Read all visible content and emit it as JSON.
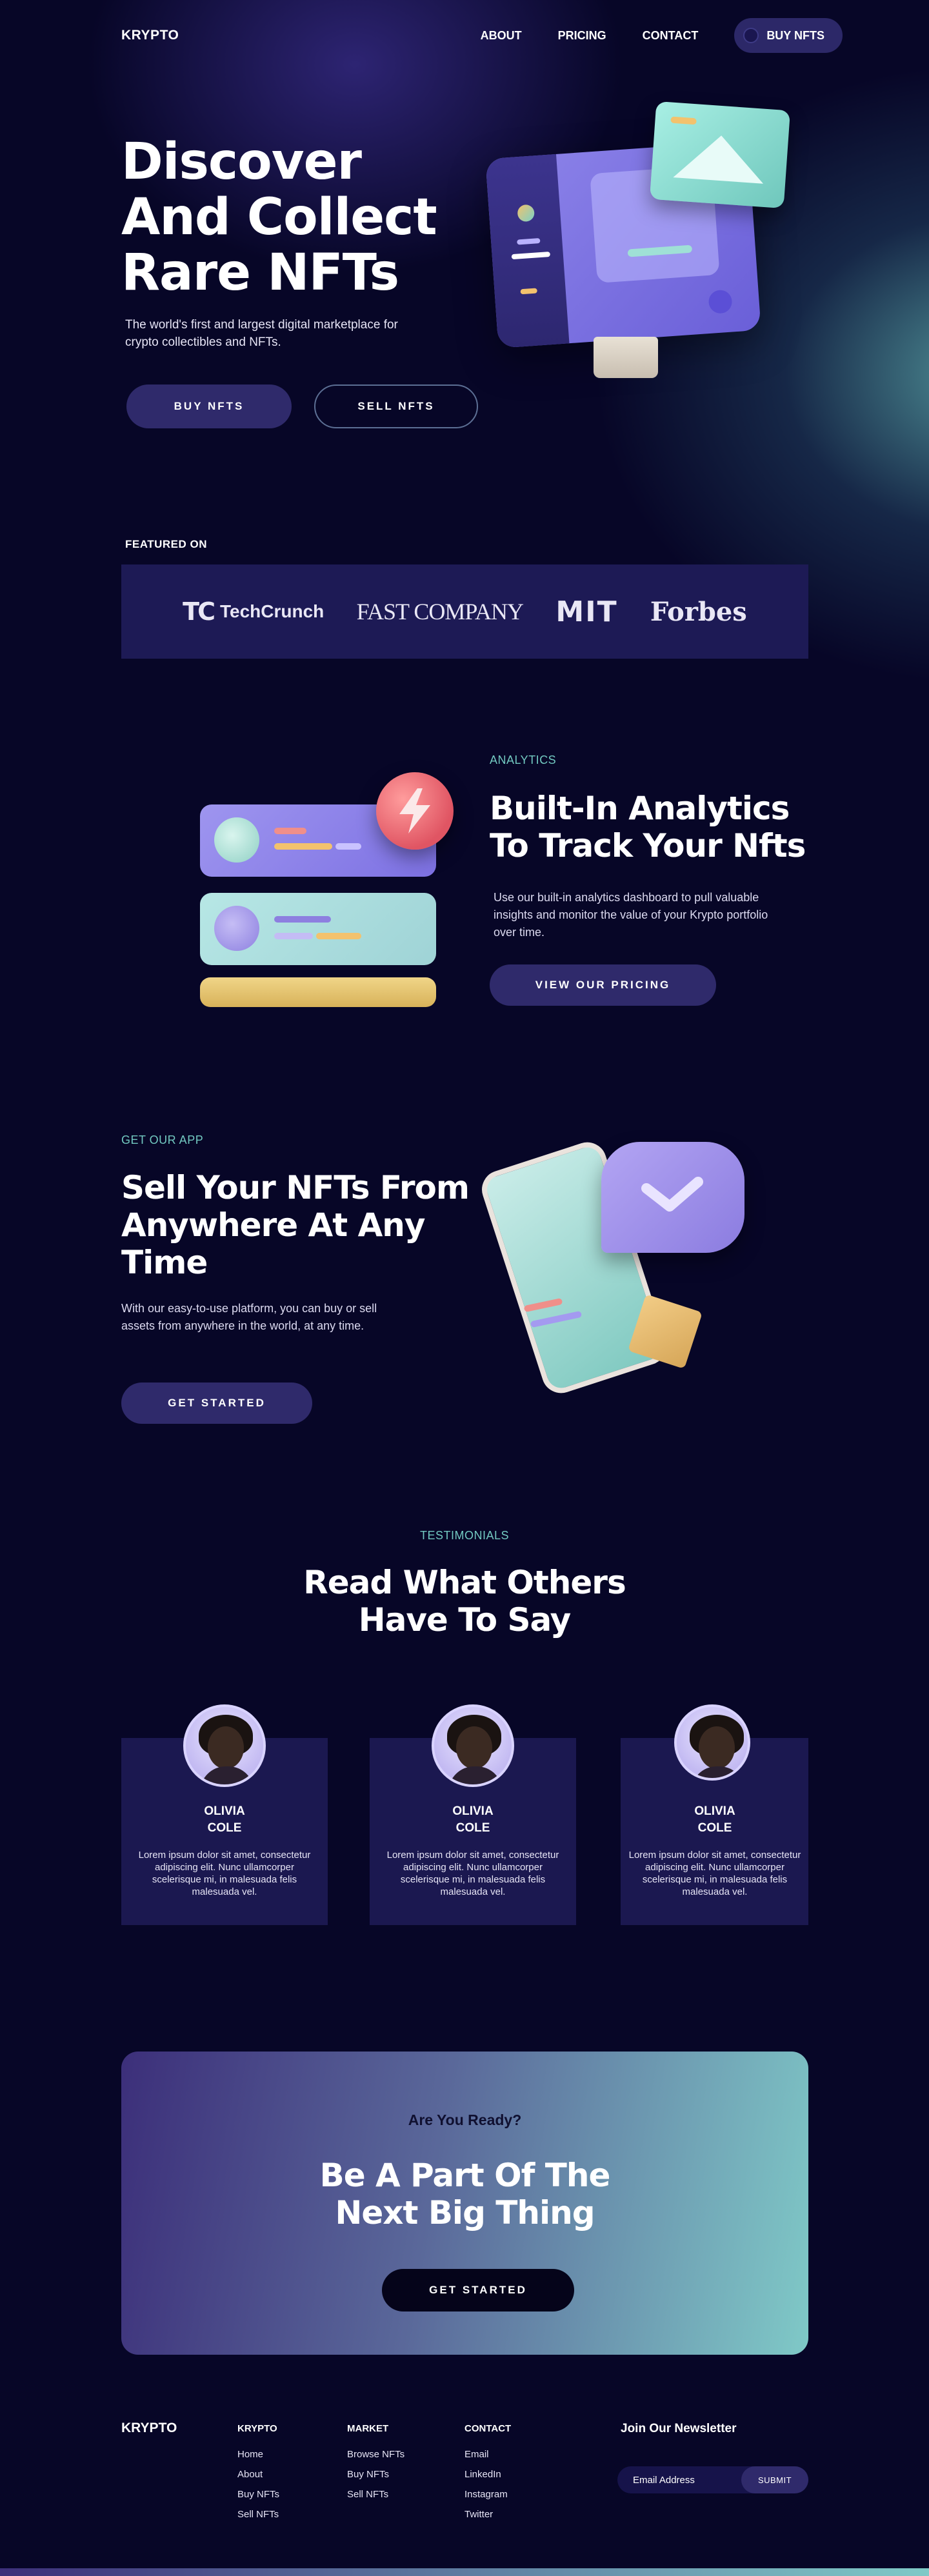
{
  "nav": {
    "logo": "KRYPTO",
    "links": [
      "ABOUT",
      "PRICING",
      "CONTACT"
    ],
    "cta": "BUY NFTS"
  },
  "hero": {
    "title_lines": [
      "Discover",
      "And Collect",
      "Rare NFTs"
    ],
    "subtitle": "The world's first and largest digital marketplace for crypto collectibles and NFTs.",
    "buy_button": "BUY NFTS",
    "sell_button": "SELL NFTS"
  },
  "featured": {
    "label": "FEATURED ON",
    "brands": [
      "TechCrunch",
      "FAST COMPANY",
      "MIT",
      "Forbes"
    ]
  },
  "analytics": {
    "eyebrow": "ANALYTICS",
    "title_lines": [
      "Built-In Analytics",
      "To Track Your Nfts"
    ],
    "body": "Use our built-in analytics dashboard to pull valuable insights and monitor the value of your Krypto portfolio over time.",
    "button": "VIEW OUR PRICING"
  },
  "app": {
    "eyebrow": "GET OUR APP",
    "title_lines": [
      "Sell Your NFTs From",
      "Anywhere At Any",
      "Time"
    ],
    "body": "With our easy-to-use platform, you can buy or sell assets from anywhere in the world, at any time.",
    "button": "GET STARTED"
  },
  "testimonials": {
    "eyebrow": "TESTIMONIALS",
    "title_lines": [
      "Read What Others",
      "Have To Say"
    ],
    "items": [
      {
        "first": "OLIVIA",
        "last": "COLE",
        "text": "Lorem ipsum dolor sit amet, consectetur adipiscing elit. Nunc ullamcorper scelerisque mi, in malesuada felis malesuada vel."
      },
      {
        "first": "OLIVIA",
        "last": "COLE",
        "text": "Lorem ipsum dolor sit amet, consectetur adipiscing elit. Nunc ullamcorper scelerisque mi, in malesuada felis malesuada vel."
      },
      {
        "first": "OLIVIA",
        "last": "COLE",
        "text": "Lorem ipsum dolor sit amet, consectetur adipiscing elit. Nunc ullamcorper scelerisque mi, in malesuada felis malesuada vel."
      }
    ]
  },
  "cta": {
    "eyebrow": "Are You Ready?",
    "title_lines": [
      "Be A Part Of The",
      "Next Big Thing"
    ],
    "button": "GET STARTED"
  },
  "footer": {
    "logo": "KRYPTO",
    "columns": [
      {
        "title": "KRYPTO",
        "links": [
          "Home",
          "About",
          "Buy NFTs",
          "Sell NFTs"
        ]
      },
      {
        "title": "MARKET",
        "links": [
          "Browse NFTs",
          "Buy NFTs",
          "Sell NFTs"
        ]
      },
      {
        "title": "CONTACT",
        "links": [
          "Email",
          "LinkedIn",
          "Instagram",
          "Twitter"
        ]
      }
    ],
    "newsletter": {
      "title": "Join Our Newsletter",
      "placeholder": "Email Address",
      "button": "SUBMIT"
    }
  },
  "colors": {
    "background": "#070627",
    "accent_purple": "#2f2a6b",
    "accent_teal": "#72c9c1",
    "panel": "#1d1a55"
  }
}
